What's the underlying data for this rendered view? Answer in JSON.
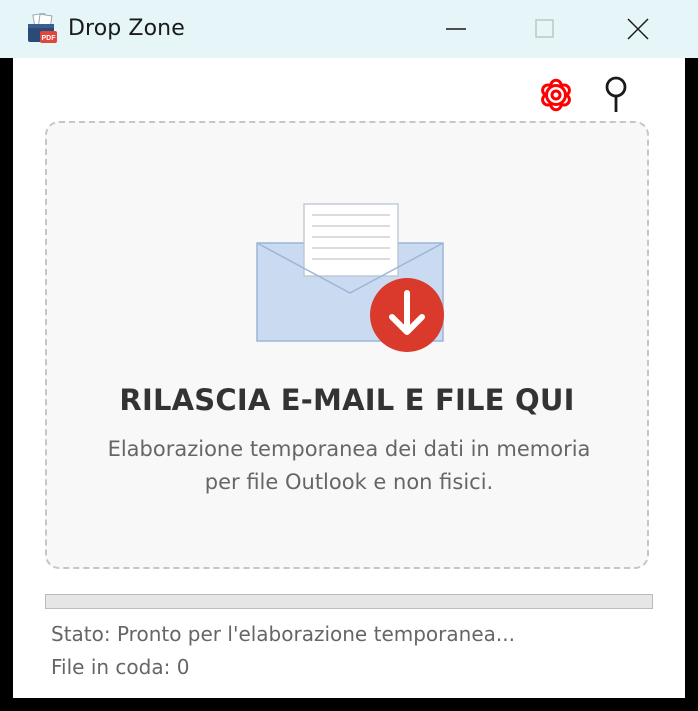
{
  "window": {
    "title": "Drop Zone",
    "app_icon": "pdf-dropzone-app-icon",
    "controls": [
      "minimize-icon",
      "maximize-icon",
      "close-icon"
    ]
  },
  "toolbar": {
    "settings_icon": "gear-icon",
    "settings_color": "#ff0000",
    "pin_icon": "pin-icon"
  },
  "dropzone": {
    "illustration_icon": "envelope-download-icon",
    "title": "RILASCIA E-MAIL E FILE QUI",
    "subtitle_line1": "Elaborazione temporanea dei dati in memoria",
    "subtitle_line2": "per file Outlook e non fisici.",
    "accent_color": "#d93a2b"
  },
  "progress": {
    "value": 0
  },
  "status": {
    "text": "Stato: Pronto per l'elaborazione temporanea...",
    "queue": "File in coda: 0"
  }
}
